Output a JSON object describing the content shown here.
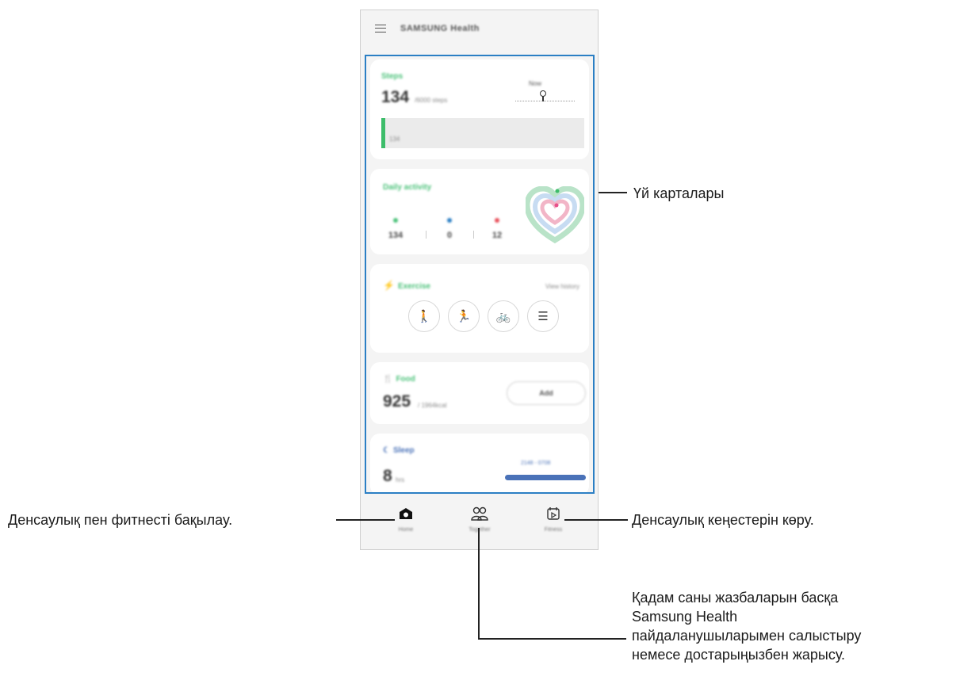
{
  "app": {
    "title": "SAMSUNG Health"
  },
  "cards": {
    "steps": {
      "title": "Steps",
      "value": "134",
      "unit": "/6000 steps",
      "bar_label": "134",
      "goal_label": "Now",
      "progress": 0.022
    },
    "daily_activity": {
      "title": "Daily activity",
      "metrics": [
        "134",
        "0",
        "12"
      ]
    },
    "exercise": {
      "title": "Exercise",
      "link": "View history",
      "buttons": [
        "walking-icon",
        "running-icon",
        "cycling-icon",
        "list-icon"
      ]
    },
    "food": {
      "title": "Food",
      "value": "925",
      "unit": "/ 1964kcal",
      "button": "Add"
    },
    "sleep": {
      "title": "Sleep",
      "value": "8",
      "unit": "hrs",
      "link": "2148 - 0708"
    }
  },
  "bottom_nav": {
    "home": "Home",
    "together": "Together",
    "fitness": "Fitness"
  },
  "callouts": {
    "home_cards": "Үй карталары",
    "track": "Денсаулық пен фитнесті бақылау.",
    "tips": "Денсаулық кеңестерін көру.",
    "compare": [
      "Қадам саны жазбаларын басқа",
      "Samsung Health",
      "пайдаланушыларымен салыстыру",
      "немесе достарыңызбен жарысу."
    ]
  },
  "colors": {
    "accent": "#2b7fc4",
    "green": "#4cc27a",
    "sleep": "#4a72b8"
  }
}
